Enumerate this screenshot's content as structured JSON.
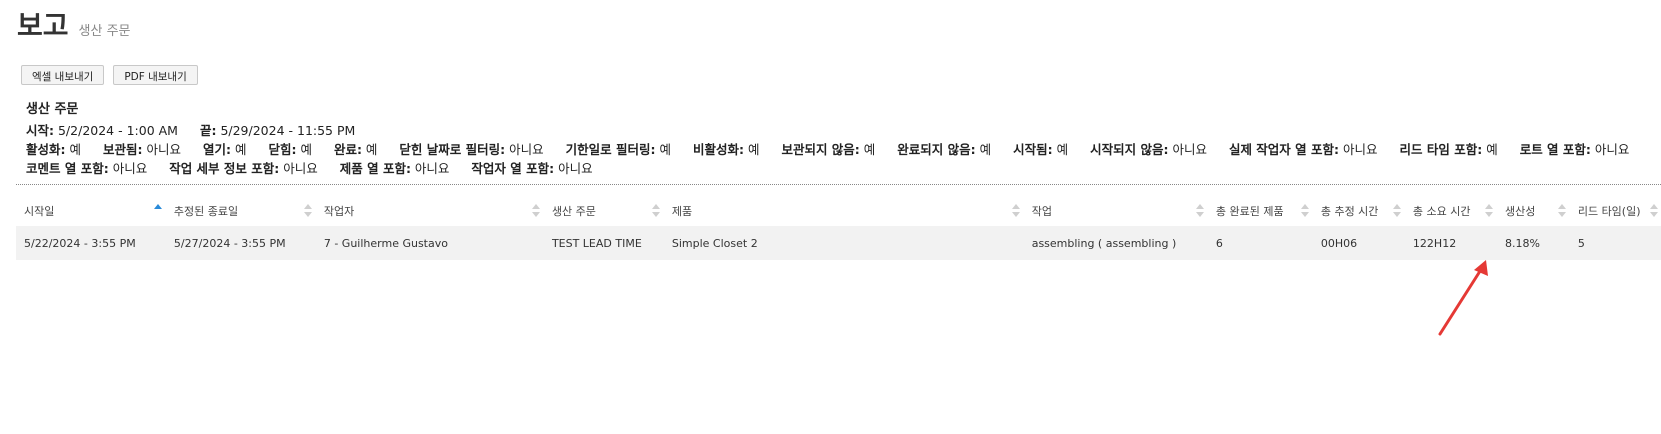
{
  "header": {
    "title": "보고",
    "subtitle": "생산 주문"
  },
  "toolbar": {
    "excel_label": "엑셀 내보내기",
    "pdf_label": "PDF 내보내기"
  },
  "filters": {
    "heading": "생산 주문",
    "start_label": "시작:",
    "start_value": "5/2/2024 - 1:00 AM",
    "end_label": "끝:",
    "end_value": "5/29/2024 - 11:55 PM",
    "items": [
      {
        "label": "활성화:",
        "value": "예"
      },
      {
        "label": "보관됨:",
        "value": "아니요"
      },
      {
        "label": "열기:",
        "value": "예"
      },
      {
        "label": "닫힘:",
        "value": "예"
      },
      {
        "label": "완료:",
        "value": "예"
      },
      {
        "label": "닫힌 날짜로 필터링:",
        "value": "아니요"
      },
      {
        "label": "기한일로 필터링:",
        "value": "예"
      },
      {
        "label": "비활성화:",
        "value": "예"
      },
      {
        "label": "보관되지 않음:",
        "value": "예"
      },
      {
        "label": "완료되지 않음:",
        "value": "예"
      },
      {
        "label": "시작됨:",
        "value": "예"
      },
      {
        "label": "시작되지 않음:",
        "value": "아니요"
      },
      {
        "label": "실제 작업자 열 포함:",
        "value": "아니요"
      },
      {
        "label": "리드 타임 포함:",
        "value": "예"
      },
      {
        "label": "로트 열 포함:",
        "value": "아니요"
      },
      {
        "label": "코멘트 열 포함:",
        "value": "아니요"
      },
      {
        "label": "작업 세부 정보 포함:",
        "value": "아니요"
      },
      {
        "label": "제품 열 포함:",
        "value": "아니요"
      },
      {
        "label": "작업자 열 포함:",
        "value": "아니요"
      }
    ]
  },
  "table": {
    "columns": [
      "시작일",
      "추정된 종료일",
      "작업자",
      "생산 주문",
      "제품",
      "작업",
      "총 완료된 제품",
      "총 추정 시간",
      "총 소요 시간",
      "생산성",
      "리드 타임(일)"
    ],
    "sorted_column": "시작일",
    "rows": [
      [
        "5/22/2024 - 3:55 PM",
        "5/27/2024 - 3:55 PM",
        "7 - Guilherme Gustavo",
        "TEST LEAD TIME",
        "Simple Closet 2",
        "assembling ( assembling )",
        "6",
        "00H06",
        "122H12",
        "8.18%",
        "5"
      ]
    ]
  },
  "colors": {
    "sort_active": "#2a8ad8",
    "annotation_arrow": "#e53935",
    "row_bg": "#f2f2f2"
  }
}
